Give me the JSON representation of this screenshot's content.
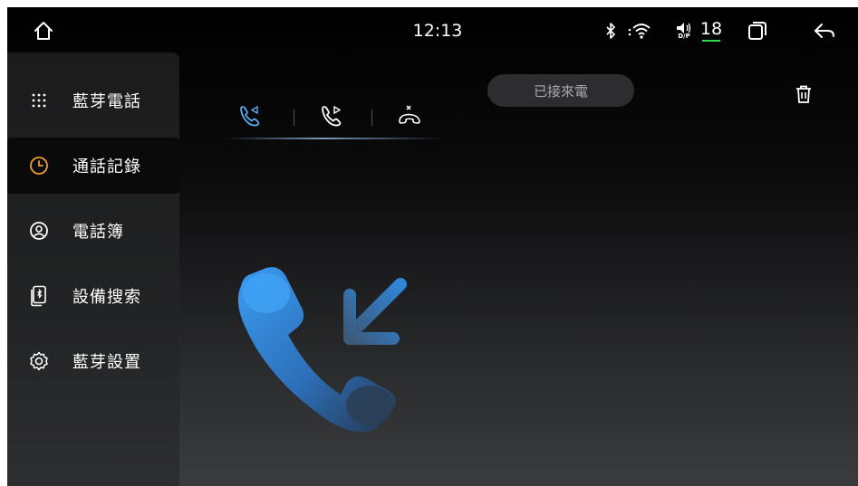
{
  "status_bar": {
    "time": "12:13",
    "volume": "18",
    "speaker_label": "D/P",
    "icons": [
      "home-icon",
      "bluetooth-icon",
      "wifi-icon",
      "speaker-icon",
      "recent-apps-icon",
      "back-icon"
    ]
  },
  "sidebar": {
    "items": [
      {
        "label": "藍芽電話",
        "icon": "dialpad-icon",
        "active": false
      },
      {
        "label": "通話記錄",
        "icon": "clock-icon",
        "active": true
      },
      {
        "label": "電話簿",
        "icon": "contact-icon",
        "active": false
      },
      {
        "label": "設備搜索",
        "icon": "device-search-icon",
        "active": false
      },
      {
        "label": "藍芽設置",
        "icon": "settings-icon",
        "active": false
      }
    ]
  },
  "call_log": {
    "tabs": [
      {
        "name": "incoming-calls",
        "icon": "incoming-call-icon",
        "selected": true
      },
      {
        "name": "outgoing-calls",
        "icon": "outgoing-call-icon",
        "selected": false
      },
      {
        "name": "missed-calls",
        "icon": "missed-call-icon",
        "selected": false
      }
    ],
    "filter_label": "已接來電",
    "delete_icon": "trash-icon",
    "illustration_icon": "incoming-call-illustration"
  },
  "colors": {
    "accent_blue": "#2f86d9",
    "active_orange": "#f0a030",
    "volume_bar": "#2fd74a"
  }
}
